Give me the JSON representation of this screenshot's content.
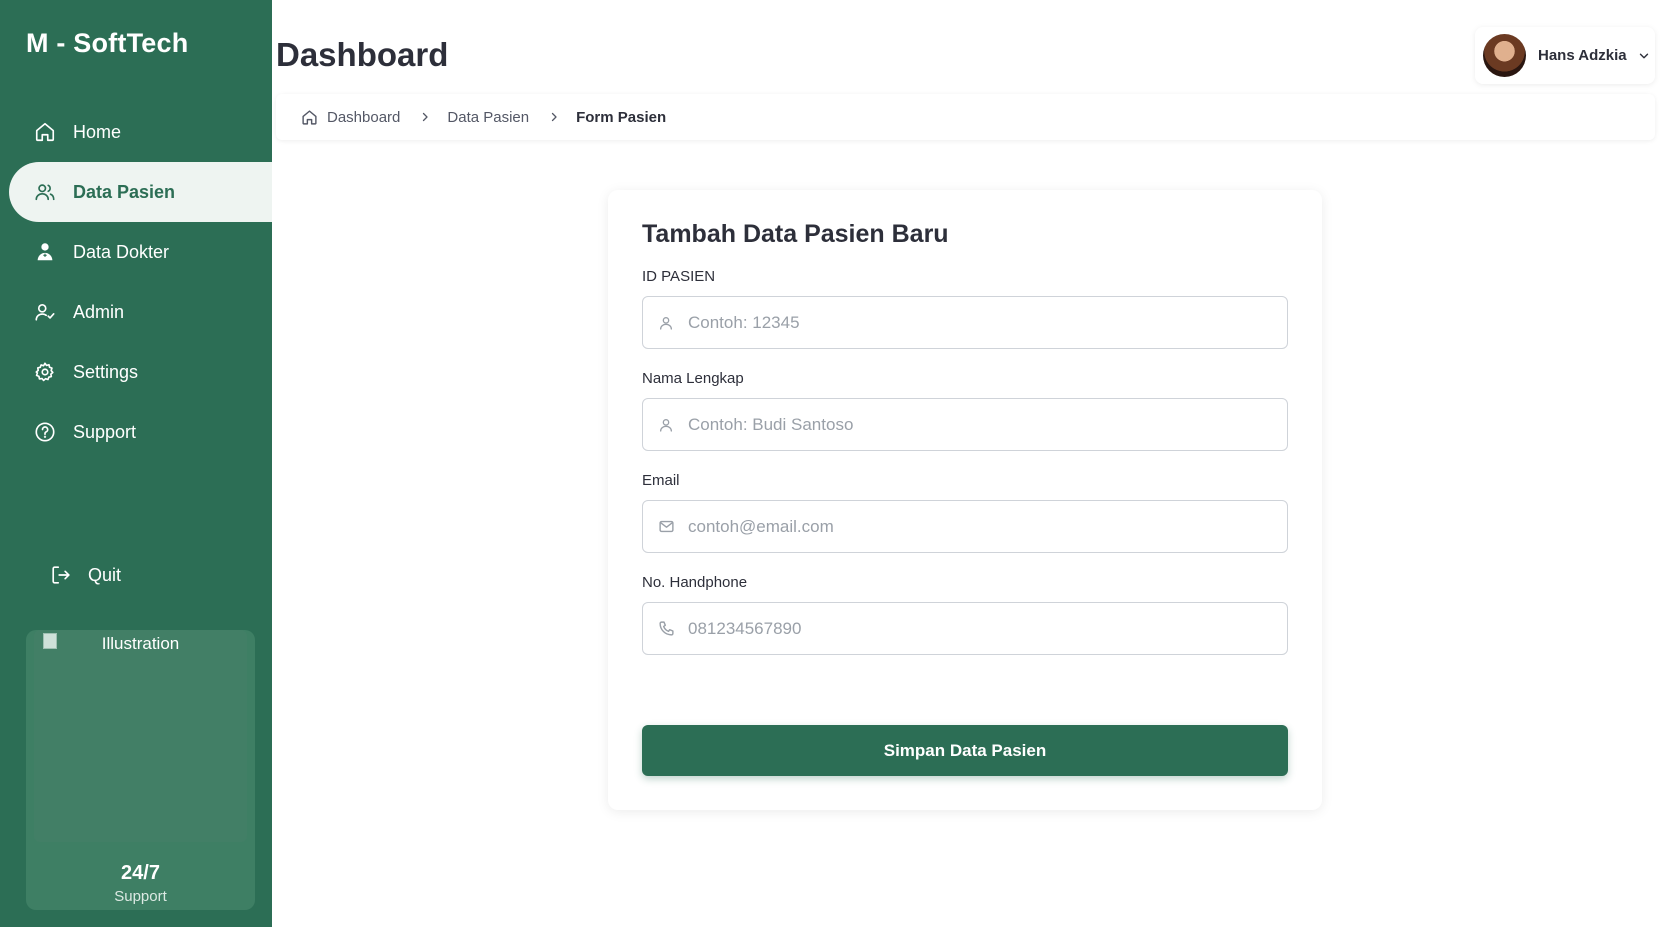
{
  "brand": "M - SoftTech",
  "sidebar": {
    "items": [
      {
        "label": "Home",
        "icon": "home-icon"
      },
      {
        "label": "Data Pasien",
        "icon": "users-icon",
        "active": true
      },
      {
        "label": "Data Dokter",
        "icon": "doctor-icon"
      },
      {
        "label": "Admin",
        "icon": "user-check-icon"
      },
      {
        "label": "Settings",
        "icon": "gear-icon"
      },
      {
        "label": "Support",
        "icon": "help-circle-icon"
      }
    ],
    "quit_label": "Quit",
    "promo": {
      "image_alt": "Illustration",
      "title": "24/7",
      "subtitle": "Support"
    }
  },
  "header": {
    "title": "Dashboard",
    "user": {
      "name": "Hans Adzkia"
    }
  },
  "breadcrumb": [
    "Dashboard",
    "Data Pasien",
    "Form Pasien"
  ],
  "form": {
    "title": "Tambah Data Pasien Baru",
    "fields": [
      {
        "label": "ID PASIEN",
        "placeholder": "Contoh: 12345",
        "value": "",
        "icon": "user-icon"
      },
      {
        "label": "Nama Lengkap",
        "placeholder": "Contoh: Budi Santoso",
        "value": "",
        "icon": "user-icon"
      },
      {
        "label": "Email",
        "placeholder": "contoh@email.com",
        "value": "",
        "icon": "mail-icon"
      },
      {
        "label": "No. Handphone",
        "placeholder": "081234567890",
        "value": "",
        "icon": "phone-icon"
      }
    ],
    "submit_label": "Simpan Data Pasien"
  },
  "colors": {
    "primary": "#2c6e55",
    "active_bg": "#eef4f1",
    "text": "#2d2f3a",
    "placeholder": "#9aa0a8"
  }
}
